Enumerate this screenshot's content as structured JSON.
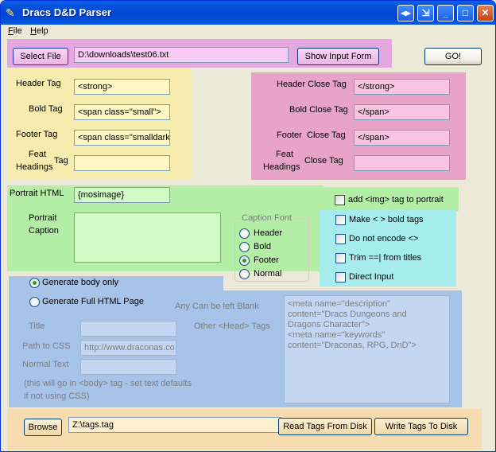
{
  "window": {
    "title": "Dracs D&D Parser"
  },
  "menu": {
    "file": "File",
    "file_key": "F",
    "file_rest": "ile",
    "help": "Help",
    "help_key": "H",
    "help_rest": "elp"
  },
  "top": {
    "select_file": "Select File",
    "file_path": "D:\\downloads\\test06.txt",
    "show_input_form": "Show Input Form",
    "go": "GO!"
  },
  "tags": {
    "header_label": "Header Tag",
    "header_value": "<strong>",
    "bold_label": "Bold Tag",
    "bold_value": "<span class=\"small\">",
    "footer_label": "Footer Tag",
    "footer_value": "<span class=\"smalldark\">",
    "feat_label_line1": "Feat",
    "feat_label_line2": "Headings",
    "feat_tag": "Tag",
    "feat_value": "",
    "header_close_label": "Header Close Tag",
    "header_close_value": "</strong>",
    "bold_close_label": "Bold Close Tag",
    "bold_close_value": "</span>",
    "footer_close_label_a": "Footer",
    "footer_close_label_b": "Close Tag",
    "footer_close_value": "</span>",
    "feat_close_line1": "Feat",
    "feat_close_line2": "Headings",
    "feat_close_tag": "Close Tag",
    "feat_close_value": ""
  },
  "portrait": {
    "html_label": "Portrait HTML",
    "html_value": "{mosimage}",
    "caption_label_line1": "Portrait",
    "caption_label_line2": "Caption",
    "caption_value": "",
    "caption_font_title": "Caption Font",
    "font_options": [
      "Header",
      "Bold",
      "Footer",
      "Normal"
    ],
    "selected_font": "Footer",
    "add_img_label": "add <img> tag to portrait"
  },
  "options": {
    "bold_tags": "Make < > bold tags",
    "no_encode": "Do not encode <>",
    "trim": "Trim ==| from titles",
    "direct": "Direct Input"
  },
  "body": {
    "generate_body_only": "Generate body only",
    "generate_full": "Generate Full HTML Page",
    "any_blank": "Any Can be left Blank",
    "title_label": "Title",
    "title_value": "",
    "css_label": "Path to CSS",
    "css_value": "http://www.draconas.co.uk",
    "normal_label": "Normal Text",
    "normal_value": "",
    "note_line1": "(this will go in  <body> tag - set text defaults",
    "note_line2": "if not using CSS)",
    "other_head_label": "Other  <Head> Tags",
    "head_tags_value": "<meta name=\"description\"\ncontent=\"Dracs Dungeons and\nDragons Character\">\n<meta name=\"keywords\"\ncontent=\"Draconas, RPG, DnD\">"
  },
  "bottom": {
    "browse": "Browse",
    "tags_path": "Z:\\tags.tag",
    "read_tags": "Read Tags From Disk",
    "write_tags": "Write Tags To Disk"
  },
  "colors": {
    "yellow": "#f5ecae",
    "pink": "#e7a3c8",
    "green": "#b4eda5",
    "cyan": "#a7eced",
    "blue": "#a7c3e8",
    "orange": "#f6dcae",
    "purple": "#e4a7df"
  }
}
